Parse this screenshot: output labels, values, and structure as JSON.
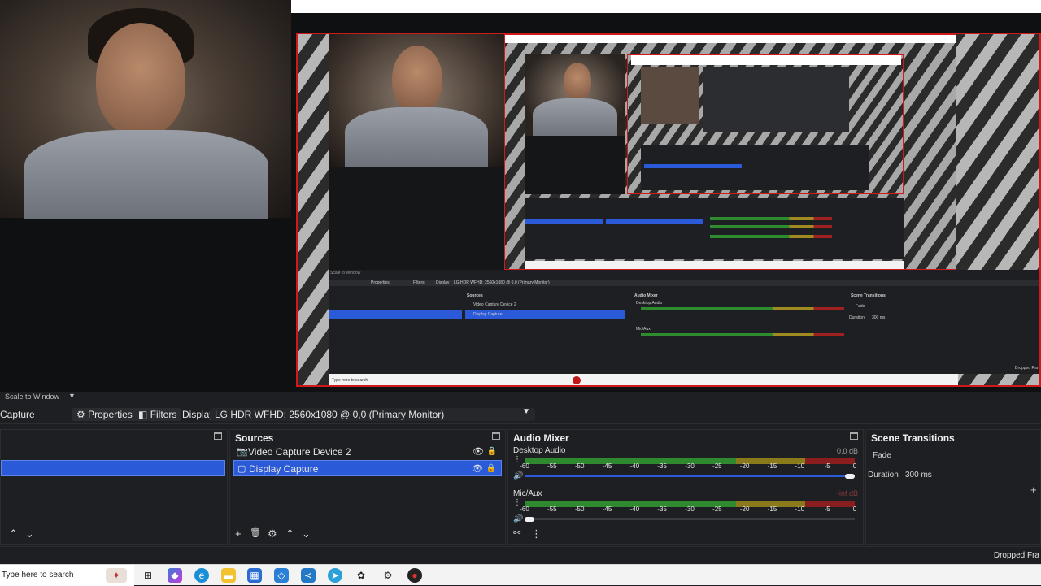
{
  "preview": {
    "scale_label": "Scale to Window",
    "inner": {
      "scale_label": "Scale to Window",
      "properties": "Properties",
      "filters": "Filters",
      "display": "Display",
      "display_value": "LG HDR WFHD: 2560x1080 @ 0,0 (Primary Monitor)",
      "sources_title": "Sources",
      "sources": [
        "Video Capture Device 2",
        "Display Capture"
      ],
      "mixer_title": "Audio Mixer",
      "mixer_channels": [
        "Desktop Audio",
        "Mic/Aux"
      ],
      "transitions_title": "Scene Transitions",
      "transition": "Fade",
      "duration_label": "Duration",
      "duration_value": "300 ms",
      "taskbar_search": "Type here to search",
      "status": "Dropped Fra"
    }
  },
  "controls": {
    "scale_label": "Scale to Window",
    "source_name": "Capture",
    "properties_label": "Properties",
    "filters_label": "Filters",
    "display_label": "Display",
    "display_value": "LG HDR WFHD: 2560x1080 @ 0,0 (Primary Monitor)"
  },
  "sources": {
    "title": "Sources",
    "items": [
      {
        "label": "Video Capture Device 2",
        "icon": "camera-icon",
        "selected": false
      },
      {
        "label": "Display Capture",
        "icon": "monitor-icon",
        "selected": true
      }
    ]
  },
  "mixer": {
    "title": "Audio Mixer",
    "channels": [
      {
        "name": "Desktop Audio",
        "db": "0.0 dB",
        "volume": 1.0
      },
      {
        "name": "Mic/Aux",
        "db": "-inf dB",
        "volume": 0.0
      }
    ],
    "ticks": [
      "-60",
      "-55",
      "-50",
      "-45",
      "-40",
      "-35",
      "-30",
      "-25",
      "-20",
      "-15",
      "-10",
      "-5",
      "0"
    ]
  },
  "transitions": {
    "title": "Scene Transitions",
    "transition": "Fade",
    "duration_label": "Duration",
    "duration_value": "300 ms"
  },
  "status": {
    "dropped": "Dropped Fra"
  },
  "taskbar": {
    "search_placeholder": "Type here to search",
    "apps": [
      "cortana-icon",
      "task-view-icon",
      "copilot-icon",
      "edge-icon",
      "file-explorer-icon",
      "store-icon",
      "network-icon",
      "vscode-icon",
      "telegram-icon",
      "chatgpt-icon",
      "settings-icon",
      "obs-icon"
    ]
  },
  "colors": {
    "accent": "#2b5ad8",
    "frame_red": "#d01a1a",
    "meter_green": "#2f8a2f",
    "meter_yellow": "#8a7a1c",
    "meter_red": "#8a1e1e"
  }
}
